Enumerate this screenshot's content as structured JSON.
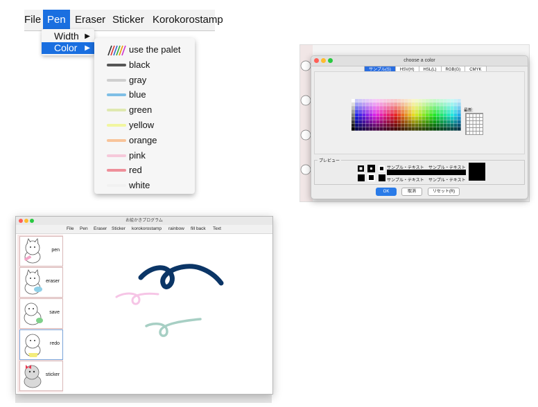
{
  "menu_screenshot": {
    "menubar": [
      "File",
      "Pen",
      "Eraser",
      "Sticker",
      "Korokorostamp"
    ],
    "active_menu": "Pen",
    "pen_submenu": [
      {
        "label": "Width",
        "arrow": "▶"
      },
      {
        "label": "Color",
        "arrow": "▶"
      }
    ],
    "color_submenu": [
      {
        "label": "use the palet",
        "color": "palette-icon"
      },
      {
        "label": "black",
        "color": "#555555"
      },
      {
        "label": "gray",
        "color": "#cfcfcf"
      },
      {
        "label": "blue",
        "color": "#7fbfe6"
      },
      {
        "label": "green",
        "color": "#dfe9b0"
      },
      {
        "label": "yellow",
        "color": "#f1f6a0"
      },
      {
        "label": "orange",
        "color": "#f8c49a"
      },
      {
        "label": "pink",
        "color": "#f6c9da"
      },
      {
        "label": "red",
        "color": "#ee8f9a"
      },
      {
        "label": "white",
        "color": "#f1f1f1"
      }
    ]
  },
  "color_chooser": {
    "title": "choose a color",
    "tabs": [
      "サンプル(S)",
      "HSV(H)",
      "HSL(L)",
      "RGB(G)",
      "CMYK"
    ],
    "recent_label": "最新:",
    "preview_label": "プレビュー",
    "sample_texts": [
      "サンプル・テキスト",
      "サンプル・テキスト",
      "サンプル・テキスト",
      "サンプル・テキスト"
    ],
    "buttons": {
      "ok": "OK",
      "cancel": "取消",
      "reset": "リセット(R)"
    }
  },
  "app_window": {
    "title": "お絵かきプログラム",
    "menu": [
      "File",
      "Pen",
      "Eraser",
      "Sticker",
      "korokorostamp",
      "rainbow",
      "fill back",
      "Text"
    ],
    "side_buttons": [
      "pen",
      "eraser",
      "save",
      "redo",
      "sticker"
    ],
    "strokes": [
      {
        "color": "#0b3566"
      },
      {
        "color": "#f6c5e6"
      },
      {
        "color": "#a7cfc4"
      }
    ]
  }
}
